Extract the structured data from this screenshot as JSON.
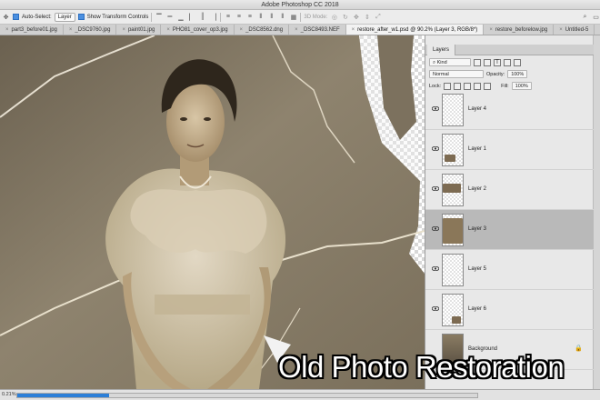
{
  "window": {
    "title": "Adobe Photoshop CC 2018"
  },
  "options_bar": {
    "auto_select_label": "Auto-Select:",
    "auto_select_value": "Layer",
    "show_transform_label": "Show Transform Controls",
    "mode_3d_label": "3D Mode:"
  },
  "tabs": [
    {
      "label": "part3_before01.jpg"
    },
    {
      "label": "_DSC9760.jpg"
    },
    {
      "label": "paint01.jpg"
    },
    {
      "label": "PHO81_cover_op3.jpg"
    },
    {
      "label": "_DSC8562.dng"
    },
    {
      "label": "_DSC8493.NEF"
    },
    {
      "label": "restore_after_w1.psd @ 90.2% (Layer 3, RGB/8*)",
      "active": true
    },
    {
      "label": "restore_beforelow.jpg"
    },
    {
      "label": "Untitled-5"
    }
  ],
  "layers_panel": {
    "tab_label": "Layers",
    "filter_label": "Kind",
    "blend_mode": "Normal",
    "opacity_label": "Opacity:",
    "opacity_value": "100%",
    "lock_label": "Lock:",
    "fill_label": "Fill:",
    "fill_value": "100%",
    "layers": [
      {
        "name": "Layer 4",
        "visible": true,
        "selected": false
      },
      {
        "name": "Layer 1",
        "visible": true,
        "selected": false
      },
      {
        "name": "Layer 2",
        "visible": true,
        "selected": false
      },
      {
        "name": "Layer 3",
        "visible": true,
        "selected": true
      },
      {
        "name": "Layer 5",
        "visible": true,
        "selected": false
      },
      {
        "name": "Layer 6",
        "visible": true,
        "selected": false
      },
      {
        "name": "Background",
        "visible": false,
        "selected": false,
        "locked": true
      }
    ]
  },
  "status_bar": {
    "zoom": "0.21%",
    "progress_fraction": 0.2
  },
  "overlay_caption": "Old Photo Restoration",
  "colors": {
    "accent_blue": "#2c7fd8",
    "sepia_dark": "#4e4536",
    "sepia_light": "#cfc3a9",
    "selected_layer": "#b9b9b9"
  }
}
